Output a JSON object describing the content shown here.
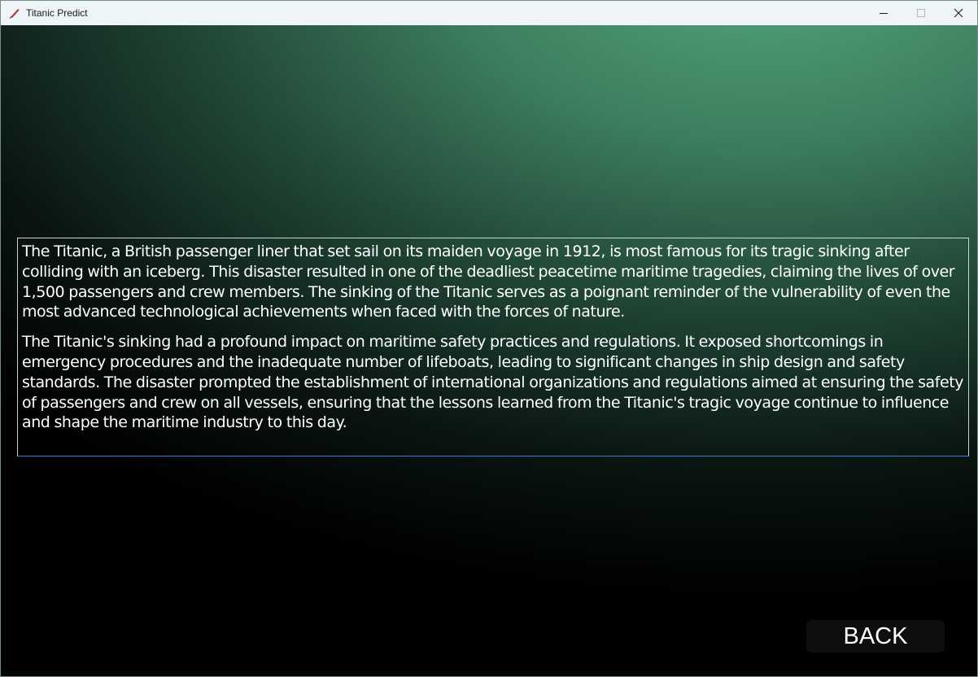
{
  "window": {
    "title": "Titanic Predict",
    "controls": {
      "minimize": "minimize-icon",
      "maximize": "maximize-icon",
      "close": "close-icon"
    }
  },
  "description": {
    "paragraphs": [
      "The Titanic, a British passenger liner that set sail on its maiden voyage in 1912, is most famous for its tragic sinking after colliding with an iceberg. This disaster resulted in one of the deadliest peacetime maritime tragedies, claiming the lives of over 1,500 passengers and crew members. The sinking of the Titanic serves as a poignant reminder of the vulnerability of even the most advanced technological achievements when faced with the forces of nature.",
      "The Titanic's sinking had a profound impact on maritime safety practices and regulations. It exposed shortcomings in emergency procedures and the inadequate number of lifeboats, leading to significant changes in ship design and safety standards. The disaster prompted the establishment of international organizations and regulations aimed at ensuring the safety of passengers and crew on all vessels, ensuring that the lessons learned from the Titanic's tragic voyage continue to influence and shape the maritime industry to this day."
    ]
  },
  "buttons": {
    "back_label": "BACK"
  },
  "colors": {
    "accent_green": "#54aa7c",
    "background_dark": "#000000",
    "text": "#ffffff",
    "focus_border": "#3a7bd5"
  }
}
